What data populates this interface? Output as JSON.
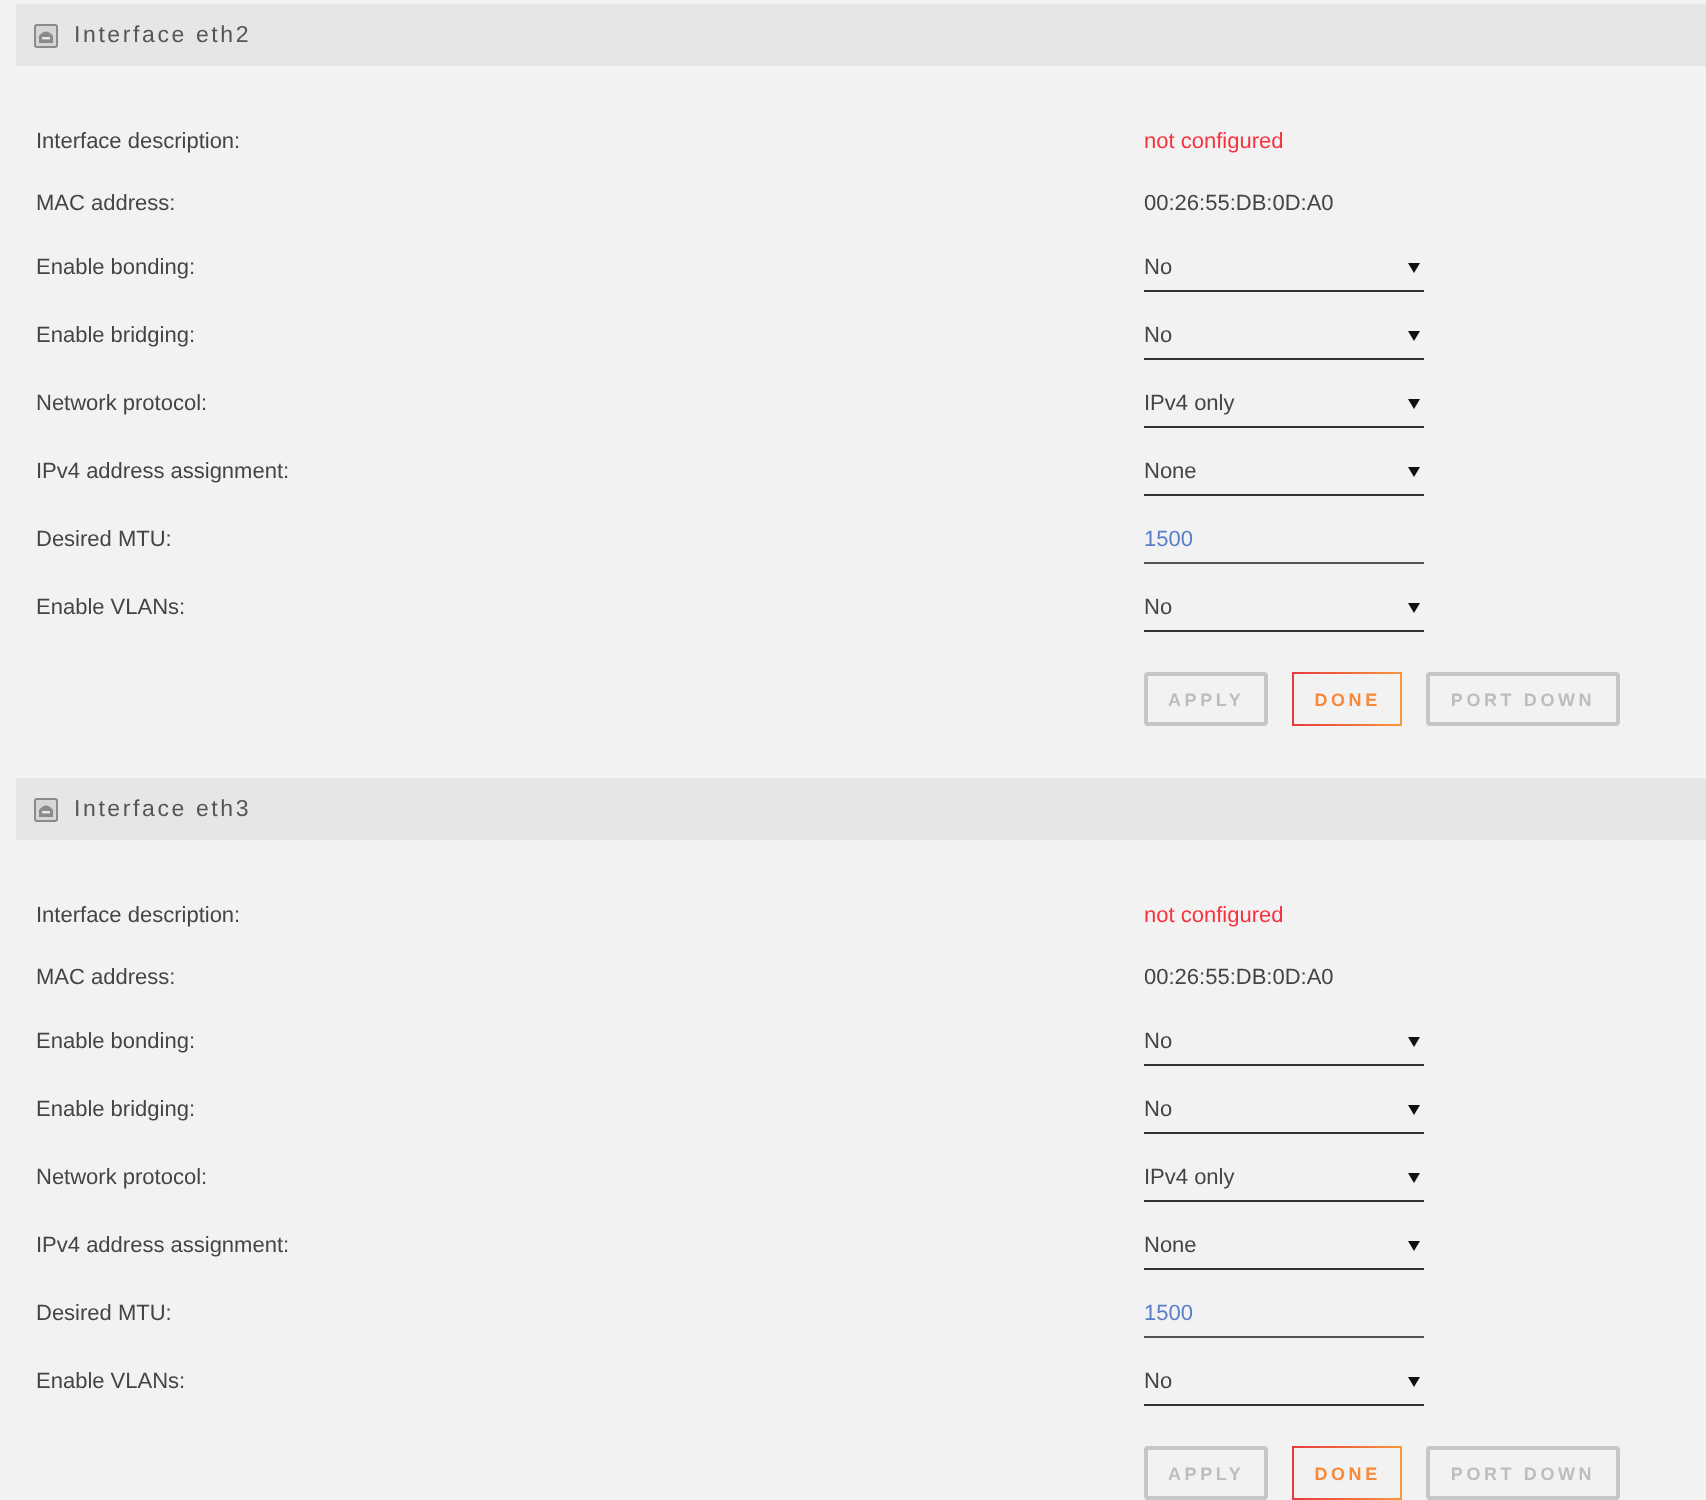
{
  "sections": [
    {
      "title": "Interface eth2",
      "fields": [
        {
          "label": "Interface description:",
          "kind": "status",
          "value": "not configured"
        },
        {
          "label": "MAC address:",
          "kind": "text",
          "value": "00:26:55:DB:0D:A0"
        },
        {
          "label": "Enable bonding:",
          "kind": "select",
          "value": "No"
        },
        {
          "label": "Enable bridging:",
          "kind": "select",
          "value": "No"
        },
        {
          "label": "Network protocol:",
          "kind": "select",
          "value": "IPv4 only"
        },
        {
          "label": "IPv4 address assignment:",
          "kind": "select",
          "value": "None"
        },
        {
          "label": "Desired MTU:",
          "kind": "input",
          "value": "1500"
        },
        {
          "label": "Enable VLANs:",
          "kind": "select",
          "value": "No"
        }
      ],
      "buttons": [
        {
          "label": "APPLY",
          "disabled": true
        },
        {
          "label": "DONE",
          "disabled": false
        },
        {
          "label": "PORT DOWN",
          "disabled": true
        }
      ]
    },
    {
      "title": "Interface eth3",
      "fields": [
        {
          "label": "Interface description:",
          "kind": "status",
          "value": "not configured"
        },
        {
          "label": "MAC address:",
          "kind": "text",
          "value": "00:26:55:DB:0D:A0"
        },
        {
          "label": "Enable bonding:",
          "kind": "select",
          "value": "No"
        },
        {
          "label": "Enable bridging:",
          "kind": "select",
          "value": "No"
        },
        {
          "label": "Network protocol:",
          "kind": "select",
          "value": "IPv4 only"
        },
        {
          "label": "IPv4 address assignment:",
          "kind": "select",
          "value": "None"
        },
        {
          "label": "Desired MTU:",
          "kind": "input",
          "value": "1500"
        },
        {
          "label": "Enable VLANs:",
          "kind": "select",
          "value": "No"
        }
      ],
      "buttons": [
        {
          "label": "APPLY",
          "disabled": true
        },
        {
          "label": "DONE",
          "disabled": false
        },
        {
          "label": "PORT DOWN",
          "disabled": true
        }
      ]
    }
  ]
}
